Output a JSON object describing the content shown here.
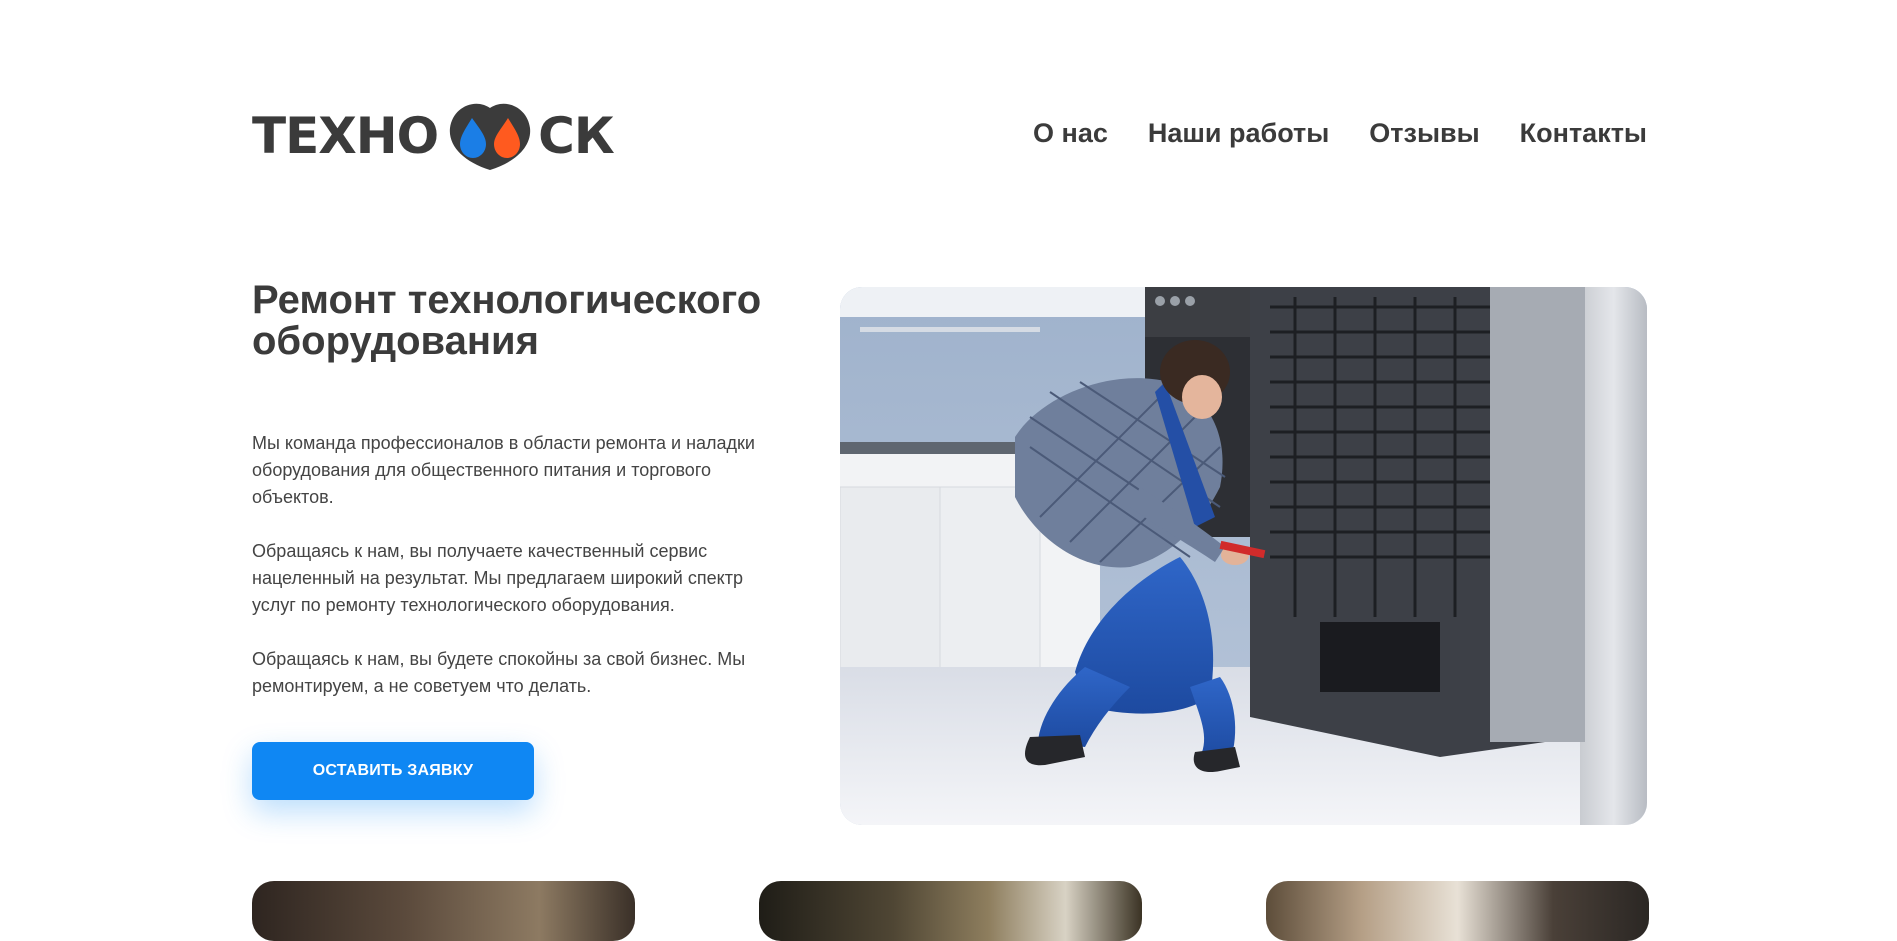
{
  "header": {
    "logo_left": "ТЕХНО",
    "logo_right": "СК",
    "logo_colors": {
      "blue": "#1b7ee6",
      "orange": "#ff5a1f",
      "dark": "#3b3b3b"
    },
    "nav": [
      "О нас",
      "Наши работы",
      "Отзывы",
      "Контакты"
    ]
  },
  "hero": {
    "title": "Ремонт технологического оборудования",
    "paragraphs": [
      "Мы команда профессионалов в области ремонта и наладки оборудования для общественного питания и торгового объектов.",
      "Обращаясь к нам, вы получаете качественный сервис нацеленный на результат. Мы предлагаем широкий спектр услуг по ремонту технологического оборудования.",
      "Обращаясь к нам, вы будете спокойны за свой бизнес. Мы ремонтируем, а не советуем что делать."
    ],
    "cta_label": "ОСТАВИТЬ ЗАЯВКУ",
    "accent_color": "#0f87f3"
  }
}
